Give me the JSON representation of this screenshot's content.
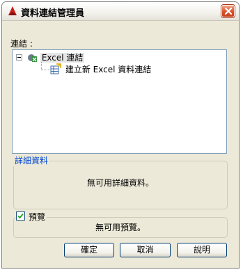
{
  "window": {
    "title": "資料連結管理員",
    "accent": "#d9532c"
  },
  "connections": {
    "label": "連結 :",
    "tree": {
      "root": {
        "label": "Excel 連結",
        "icon": "excel-link-icon",
        "expanded": true
      },
      "child": {
        "label": "建立新 Excel 資料連結",
        "icon": "new-excel-link-icon"
      }
    }
  },
  "details": {
    "legend": "詳細資料",
    "message": "無可用詳細資料。"
  },
  "preview": {
    "legend": "預覽",
    "checked": true,
    "message": "無可用預覽。"
  },
  "buttons": {
    "ok": "確定",
    "cancel": "取消",
    "help": "說明"
  }
}
